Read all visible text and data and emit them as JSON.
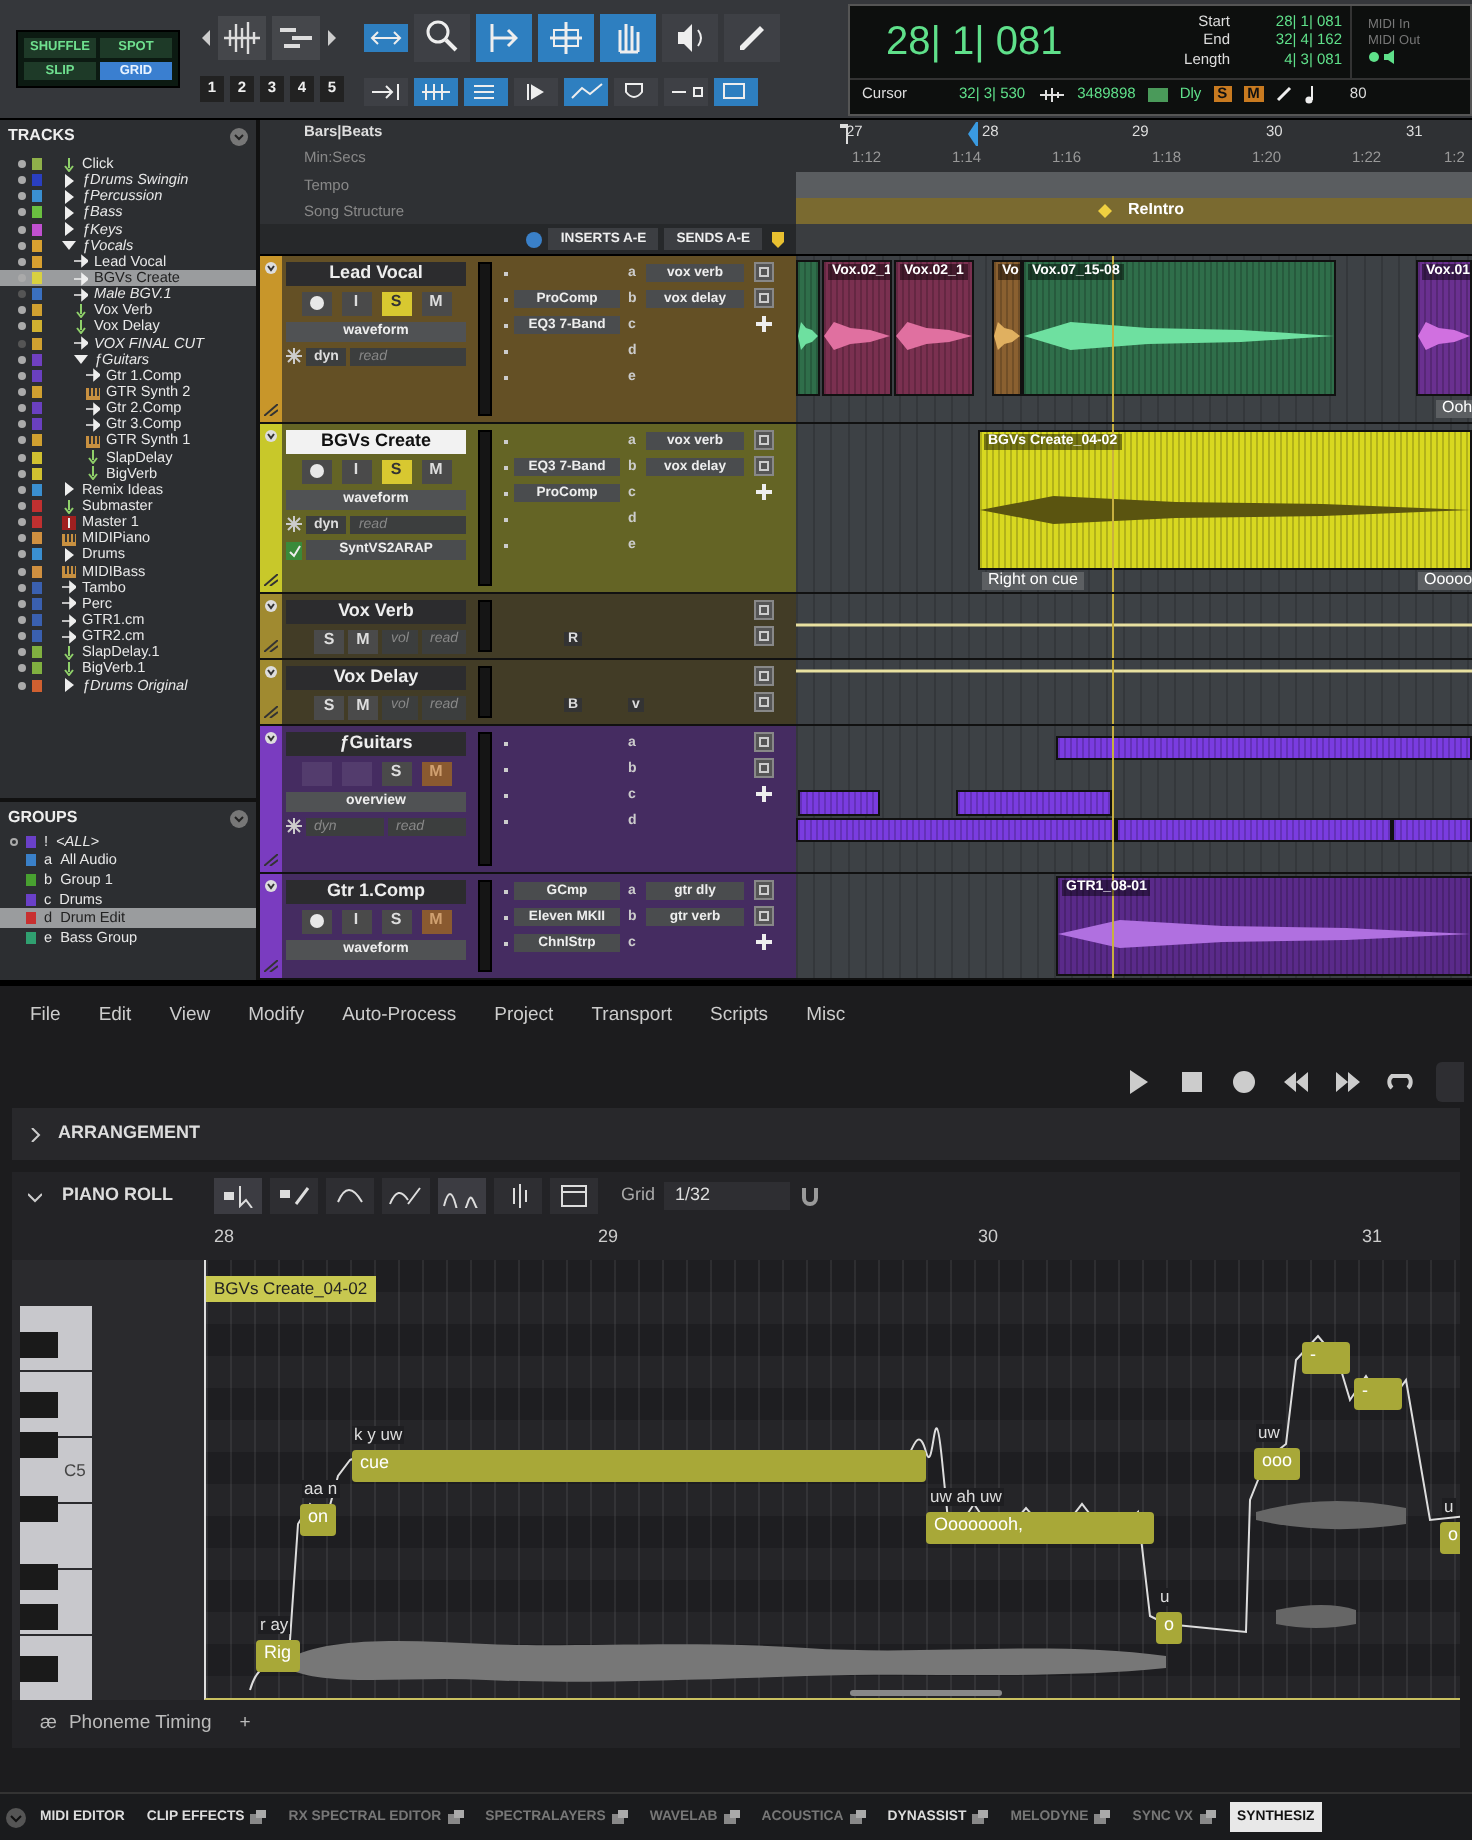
{
  "toolbar": {
    "edit_modes": [
      {
        "label": "SHUFFLE",
        "selected": false
      },
      {
        "label": "SPOT",
        "selected": false
      },
      {
        "label": "SLIP",
        "selected": false
      },
      {
        "label": "GRID",
        "selected": true
      }
    ],
    "zoom_presets": [
      "1",
      "2",
      "3",
      "4",
      "5"
    ],
    "tools": [
      {
        "kind": "zoom",
        "selected": false
      },
      {
        "kind": "trim",
        "selected": true
      },
      {
        "kind": "selector",
        "selected": true
      },
      {
        "kind": "grabber",
        "selected": true
      },
      {
        "kind": "scrubber",
        "selected": false
      },
      {
        "kind": "pencil",
        "selected": false
      }
    ],
    "toggles": [
      {
        "on": false
      },
      {
        "on": true
      },
      {
        "on": true
      },
      {
        "on": false
      },
      {
        "on": true
      },
      {
        "on": false
      },
      {
        "on": false
      },
      {
        "on": true
      }
    ]
  },
  "counter": {
    "main": "28| 1| 081",
    "fields": [
      {
        "label": "Start",
        "value": "28| 1| 081"
      },
      {
        "label": "End",
        "value": "32| 4| 162"
      },
      {
        "label": "Length",
        "value": "4| 3| 081"
      }
    ],
    "midi": [
      "MIDI In",
      "MIDI Out"
    ],
    "cursor_label": "Cursor",
    "cursor": "32| 3| 530",
    "sample_value": "3489898",
    "delay_label": "Dly",
    "solo_label": "S",
    "mute_label": "M",
    "tempo": "80"
  },
  "tracks_panel": {
    "title": "TRACKS",
    "items": [
      {
        "name": "Click",
        "kind": "aux",
        "color": "#8fb04a",
        "selected": false,
        "inactive": false
      },
      {
        "name": "ƒDrums Swingin",
        "kind": "folder",
        "color": "#2a3fc0",
        "selected": false,
        "inactive": false,
        "expanded": false
      },
      {
        "name": "ƒPercussion",
        "kind": "folder",
        "color": "#3a8fd0",
        "selected": false,
        "inactive": false,
        "expanded": false
      },
      {
        "name": "ƒBass",
        "kind": "folder",
        "color": "#6ac040",
        "selected": false,
        "inactive": false,
        "expanded": false
      },
      {
        "name": "ƒKeys",
        "kind": "folder",
        "color": "#c050d0",
        "selected": false,
        "inactive": false,
        "expanded": false
      },
      {
        "name": "ƒVocals",
        "kind": "folder",
        "color": "#d8a030",
        "selected": false,
        "inactive": false,
        "expanded": true,
        "children": [
          {
            "name": "Lead Vocal",
            "kind": "audio",
            "color": "#d8a030",
            "selected": false,
            "inactive": false
          },
          {
            "name": "BGVs Create",
            "kind": "audio",
            "color": "#d8d040",
            "selected": true,
            "inactive": false
          },
          {
            "name": "Male BGV.1",
            "kind": "audio",
            "color": "#3a70c0",
            "selected": false,
            "inactive": true
          },
          {
            "name": "Vox Verb",
            "kind": "aux",
            "color": "#d0a030",
            "selected": false,
            "inactive": false
          },
          {
            "name": "Vox Delay",
            "kind": "aux",
            "color": "#d0b030",
            "selected": false,
            "inactive": false
          },
          {
            "name": "VOX FINAL CUT",
            "kind": "audio",
            "color": "#d0a030",
            "selected": false,
            "inactive": true
          },
          {
            "name": "ƒGuitars",
            "kind": "folder",
            "color": "#7040c0",
            "selected": false,
            "inactive": false,
            "expanded": true,
            "children": [
              {
                "name": "Gtr 1.Comp",
                "kind": "audio",
                "color": "#6a40c0",
                "selected": false,
                "inactive": false
              },
              {
                "name": "GTR Synth 2",
                "kind": "instrument",
                "color": "#d0a030",
                "selected": false,
                "inactive": false
              },
              {
                "name": "Gtr 2.Comp",
                "kind": "audio",
                "color": "#6a40c0",
                "selected": false,
                "inactive": false
              },
              {
                "name": "Gtr 3.Comp",
                "kind": "audio",
                "color": "#6a40c0",
                "selected": false,
                "inactive": false
              },
              {
                "name": "GTR Synth 1",
                "kind": "instrument",
                "color": "#d0a030",
                "selected": false,
                "inactive": false
              },
              {
                "name": "SlapDelay",
                "kind": "aux",
                "color": "#d0c030",
                "selected": false,
                "inactive": false
              },
              {
                "name": "BigVerb",
                "kind": "aux",
                "color": "#d0c030",
                "selected": false,
                "inactive": false
              }
            ]
          }
        ]
      },
      {
        "name": "Remix Ideas",
        "kind": "basic_folder",
        "color": "#3a8fd0",
        "selected": false,
        "inactive": false,
        "expanded": false
      },
      {
        "name": "Submaster",
        "kind": "aux",
        "color": "#c03030",
        "selected": false,
        "inactive": false
      },
      {
        "name": "Master 1",
        "kind": "master",
        "color": "#c03030",
        "selected": false,
        "inactive": false
      },
      {
        "name": "MIDIPiano",
        "kind": "instrument",
        "color": "#d09040",
        "selected": false,
        "inactive": false
      },
      {
        "name": "Drums",
        "kind": "basic_folder",
        "color": "#3a8fd0",
        "selected": false,
        "inactive": false,
        "expanded": false
      },
      {
        "name": "MIDIBass",
        "kind": "instrument",
        "color": "#d09040",
        "selected": false,
        "inactive": false
      },
      {
        "name": "Tambo",
        "kind": "audio",
        "color": "#3a60b0",
        "selected": false,
        "inactive": false
      },
      {
        "name": "Perc",
        "kind": "audio",
        "color": "#3a60b0",
        "selected": false,
        "inactive": false
      },
      {
        "name": "GTR1.cm",
        "kind": "audio",
        "color": "#3a60b0",
        "selected": false,
        "inactive": false
      },
      {
        "name": "GTR2.cm",
        "kind": "audio",
        "color": "#3a60b0",
        "selected": false,
        "inactive": false
      },
      {
        "name": "SlapDelay.1",
        "kind": "aux",
        "color": "#80b040",
        "selected": false,
        "inactive": false
      },
      {
        "name": "BigVerb.1",
        "kind": "aux",
        "color": "#80b040",
        "selected": false,
        "inactive": false
      },
      {
        "name": "ƒDrums Original",
        "kind": "folder",
        "color": "#d06030",
        "selected": false,
        "inactive": false,
        "expanded": false
      }
    ]
  },
  "groups_panel": {
    "title": "GROUPS",
    "items": [
      {
        "id": "!",
        "name": "<ALL>",
        "kind": "all",
        "color": "#6a40c8",
        "selected": false
      },
      {
        "id": "a",
        "name": "All Audio",
        "kind": "group",
        "color": "#3a80c8",
        "selected": false
      },
      {
        "id": "b",
        "name": "Group 1",
        "kind": "group",
        "color": "#48a030",
        "selected": false
      },
      {
        "id": "c",
        "name": "Drums",
        "kind": "group",
        "color": "#6a40c8",
        "selected": false
      },
      {
        "id": "d",
        "name": "Drum Edit",
        "kind": "group",
        "color": "#c83030",
        "selected": true
      },
      {
        "id": "e",
        "name": "Bass Group",
        "kind": "group",
        "color": "#30a070",
        "selected": false
      }
    ]
  },
  "rulers": {
    "names": [
      "Bars|Beats",
      "Min:Secs",
      "Tempo",
      "Song Structure"
    ],
    "bars": [
      "27",
      "28",
      "29",
      "30",
      "31"
    ],
    "times": [
      "1:12",
      "1:14",
      "1:16",
      "1:18",
      "1:20",
      "1:22",
      "1:2"
    ],
    "markers": [
      {
        "label": "ReIntro"
      }
    ]
  },
  "mix_header": {
    "inserts": "INSERTS A-E",
    "sends": "SENDS A-E"
  },
  "tracks": [
    {
      "name": "Lead Vocal",
      "kind": "audio",
      "color": "#c8962a",
      "selected": false,
      "buttons": [
        {
          "kind": "record"
        },
        {
          "kind": "input",
          "label": "I"
        },
        {
          "kind": "solo",
          "label": "S",
          "on": true
        },
        {
          "kind": "mute",
          "label": "M",
          "on": false,
          "implied": false
        }
      ],
      "view": "waveform",
      "automation": [
        "dyn",
        "read"
      ],
      "inserts": [
        {
          "kind": "empty"
        },
        {
          "kind": "plugin",
          "name": "ProComp"
        },
        {
          "kind": "plugin",
          "name": "EQ3 7-Band"
        },
        {
          "kind": "empty"
        },
        {
          "kind": "empty"
        }
      ],
      "sends": [
        {
          "slot": "a",
          "name": "vox verb"
        },
        {
          "slot": "b",
          "name": "vox delay"
        },
        {
          "slot": "c"
        },
        {
          "slot": "d"
        },
        {
          "slot": "e"
        }
      ],
      "clips": [
        {
          "color": "#2f6e4a"
        },
        {
          "label": "Vox.02_1",
          "color": "#7a3050"
        },
        {
          "label": "Vox.02_1",
          "color": "#7a3050"
        },
        {
          "label": "Vo",
          "color": "#8a6030"
        },
        {
          "label": "Vox.07_15-08",
          "color": "#2f6e4a"
        },
        {
          "label": "Vox.01",
          "color": "#6a3090"
        }
      ],
      "lyrics": [
        "Ooh"
      ]
    },
    {
      "name": "BGVs Create",
      "kind": "audio",
      "color": "#c8c82a",
      "selected": true,
      "buttons": [
        {
          "kind": "record"
        },
        {
          "kind": "input",
          "label": "I"
        },
        {
          "kind": "solo",
          "label": "S",
          "on": true
        },
        {
          "kind": "mute",
          "label": "M",
          "on": false,
          "implied": false
        }
      ],
      "view": "waveform",
      "automation": [
        "dyn",
        "read"
      ],
      "input_plugin": "SyntVS2ARAP",
      "inserts": [
        {
          "kind": "empty"
        },
        {
          "kind": "plugin",
          "name": "EQ3 7-Band"
        },
        {
          "kind": "plugin",
          "name": "ProComp"
        },
        {
          "kind": "empty"
        },
        {
          "kind": "empty"
        }
      ],
      "sends": [
        {
          "slot": "a",
          "name": "vox verb"
        },
        {
          "slot": "b",
          "name": "vox delay"
        },
        {
          "slot": "c"
        },
        {
          "slot": "d"
        },
        {
          "slot": "e"
        }
      ],
      "clips": [
        {
          "label": "BGVs Create_04-02",
          "color": "#d8d820"
        }
      ],
      "lyrics": [
        "Right  on  cue",
        "Ooooo"
      ]
    },
    {
      "name": "Vox Verb",
      "kind": "aux",
      "color": "#a08a30",
      "selected": false,
      "buttons": [
        {
          "kind": "solo",
          "label": "S",
          "on": false
        },
        {
          "kind": "mute",
          "label": "M",
          "on": false,
          "implied": false
        }
      ],
      "automation": [
        "vol",
        "read"
      ],
      "insert_tag": "R"
    },
    {
      "name": "Vox Delay",
      "kind": "aux",
      "color": "#a08a30",
      "selected": false,
      "buttons": [
        {
          "kind": "solo",
          "label": "S",
          "on": false
        },
        {
          "kind": "mute",
          "label": "M",
          "on": false,
          "implied": false
        }
      ],
      "automation": [
        "vol",
        "read"
      ],
      "insert_tag": "B",
      "send_tag": "v"
    },
    {
      "name": "ƒGuitars",
      "kind": "folder",
      "color": "#7a3cc0",
      "selected": false,
      "buttons": [
        {
          "kind": "blank"
        },
        {
          "kind": "blank"
        },
        {
          "kind": "solo",
          "label": "S",
          "on": false
        },
        {
          "kind": "mute",
          "label": "M",
          "on": false,
          "implied": true
        }
      ],
      "view": "overview",
      "automation": [
        "dyn",
        "read"
      ],
      "inserts": [
        {
          "kind": "empty"
        },
        {
          "kind": "empty"
        },
        {
          "kind": "empty"
        },
        {
          "kind": "empty"
        }
      ],
      "sends": [
        {
          "slot": "a"
        },
        {
          "slot": "b"
        },
        {
          "slot": "c"
        },
        {
          "slot": "d"
        }
      ],
      "clips": [
        {
          "color": "#7a3ce0"
        },
        {
          "color": "#7a3ce0"
        },
        {
          "color": "#7a3ce0"
        },
        {
          "color": "#7a3ce0"
        },
        {
          "color": "#7a3ce0"
        },
        {
          "color": "#7a3ce0"
        }
      ]
    },
    {
      "name": "Gtr 1.Comp",
      "kind": "audio",
      "color": "#7a3cc0",
      "selected": false,
      "buttons": [
        {
          "kind": "record"
        },
        {
          "kind": "input",
          "label": "I"
        },
        {
          "kind": "solo",
          "label": "S",
          "on": false
        },
        {
          "kind": "mute",
          "label": "M",
          "on": false,
          "implied": true
        }
      ],
      "view": "waveform",
      "inserts": [
        {
          "kind": "plugin",
          "name": "GCmp"
        },
        {
          "kind": "plugin",
          "name": "Eleven MKII"
        },
        {
          "kind": "plugin",
          "name": "ChnlStrp"
        }
      ],
      "sends": [
        {
          "slot": "a",
          "name": "gtr dly"
        },
        {
          "slot": "b",
          "name": "gtr verb"
        },
        {
          "slot": "c"
        }
      ],
      "clips": [
        {
          "label": "GTR1_08-01",
          "color": "#5a2a8a"
        }
      ]
    }
  ],
  "editor": {
    "menu": [
      "File",
      "Edit",
      "View",
      "Modify",
      "Auto-Process",
      "Project",
      "Transport",
      "Scripts",
      "Misc"
    ],
    "sections": [
      {
        "title": "ARRANGEMENT",
        "expanded": false
      },
      {
        "title": "PIANO ROLL",
        "expanded": true
      }
    ],
    "tools": [
      {
        "kind": "select",
        "selected": true
      },
      {
        "kind": "draw",
        "selected": false
      },
      {
        "kind": "curve",
        "selected": false
      },
      {
        "kind": "curve_draw",
        "selected": false
      },
      {
        "kind": "pitch",
        "selected": true
      },
      {
        "kind": "waveform",
        "selected": false
      },
      {
        "kind": "clip",
        "selected": false
      }
    ],
    "grid_label": "Grid",
    "grid_value": "1/32",
    "ruler": [
      "28",
      "29",
      "30",
      "31"
    ],
    "clip_label": "BGVs Create_04-02",
    "key_label": "C5",
    "notes": [
      {
        "lyric": "Rig",
        "phonemes": "r ay"
      },
      {
        "lyric": "on",
        "phonemes": "aa n"
      },
      {
        "lyric": "cue",
        "phonemes": "k y uw"
      },
      {
        "lyric": "Oooooooh,",
        "phonemes": "uw ah uw"
      },
      {
        "lyric": "o",
        "phonemes": "u"
      },
      {
        "lyric": "ooo",
        "phonemes": "uw"
      },
      {
        "lyric": "-"
      },
      {
        "lyric": "-"
      },
      {
        "lyric": "o",
        "phonemes": "u"
      }
    ],
    "footer": {
      "icon_text": "æ",
      "label": "Phoneme Timing",
      "add": "+"
    }
  },
  "bottom_tabs": [
    {
      "label": "MIDI EDITOR",
      "selected": false,
      "bright": true,
      "detachable": false
    },
    {
      "label": "CLIP EFFECTS",
      "selected": false,
      "bright": true,
      "detachable": true
    },
    {
      "label": "RX SPECTRAL EDITOR",
      "selected": false,
      "bright": false,
      "detachable": true
    },
    {
      "label": "SPECTRALAYERS",
      "selected": false,
      "bright": false,
      "detachable": true
    },
    {
      "label": "WAVELAB",
      "selected": false,
      "bright": false,
      "detachable": true
    },
    {
      "label": "ACOUSTICA",
      "selected": false,
      "bright": false,
      "detachable": true
    },
    {
      "label": "DYNASSIST",
      "selected": false,
      "bright": true,
      "detachable": true
    },
    {
      "label": "MELODYNE",
      "selected": false,
      "bright": false,
      "detachable": true
    },
    {
      "label": "SYNC VX",
      "selected": false,
      "bright": false,
      "detachable": true
    },
    {
      "label": "SYNTHESIZ",
      "selected": true,
      "bright": true,
      "detachable": false
    }
  ]
}
